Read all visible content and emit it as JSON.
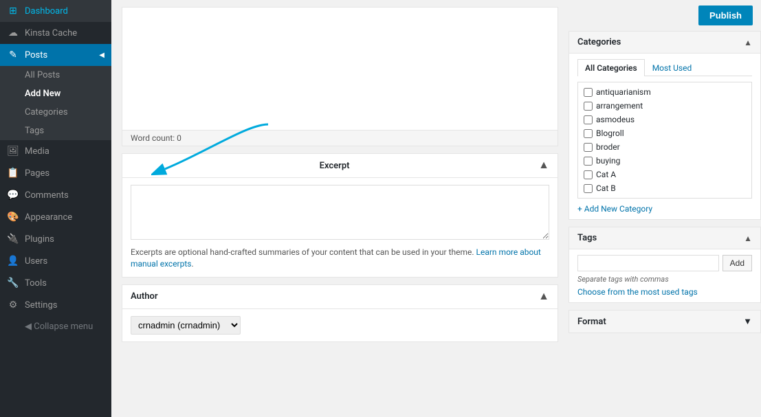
{
  "sidebar": {
    "items": [
      {
        "id": "dashboard",
        "label": "Dashboard",
        "icon": "⊞"
      },
      {
        "id": "kinsta-cache",
        "label": "Kinsta Cache",
        "icon": "☁"
      },
      {
        "id": "posts",
        "label": "Posts",
        "icon": "📄",
        "active": true
      },
      {
        "id": "media",
        "label": "Media",
        "icon": "🖼"
      },
      {
        "id": "pages",
        "label": "Pages",
        "icon": "📋"
      },
      {
        "id": "comments",
        "label": "Comments",
        "icon": "💬"
      },
      {
        "id": "appearance",
        "label": "Appearance",
        "icon": "🎨"
      },
      {
        "id": "plugins",
        "label": "Plugins",
        "icon": "🔌"
      },
      {
        "id": "users",
        "label": "Users",
        "icon": "👤"
      },
      {
        "id": "tools",
        "label": "Tools",
        "icon": "🔧"
      },
      {
        "id": "settings",
        "label": "Settings",
        "icon": "⚙"
      }
    ],
    "posts_subitems": [
      {
        "id": "all-posts",
        "label": "All Posts"
      },
      {
        "id": "add-new",
        "label": "Add New",
        "active": true
      },
      {
        "id": "categories",
        "label": "Categories"
      },
      {
        "id": "tags",
        "label": "Tags"
      }
    ],
    "collapse_label": "Collapse menu"
  },
  "main": {
    "word_count_label": "Word count: 0",
    "excerpt_section": {
      "title": "Excerpt",
      "placeholder": "",
      "help_text": "Excerpts are optional hand-crafted summaries of your content that can be used in your theme.",
      "learn_more_text": "Learn more about manual excerpts",
      "learn_more_url": "#"
    },
    "author_section": {
      "title": "Author",
      "selected": "crnadmin (crnadmin)"
    }
  },
  "right_panel": {
    "publish_button": "Publish",
    "categories": {
      "title": "Categories",
      "tabs": [
        {
          "id": "all",
          "label": "All Categories",
          "active": true
        },
        {
          "id": "most-used",
          "label": "Most Used"
        }
      ],
      "items": [
        {
          "label": "antiquarianism",
          "checked": false
        },
        {
          "label": "arrangement",
          "checked": false
        },
        {
          "label": "asmodeus",
          "checked": false
        },
        {
          "label": "Blogroll",
          "checked": false
        },
        {
          "label": "broder",
          "checked": false
        },
        {
          "label": "buying",
          "checked": false
        },
        {
          "label": "Cat A",
          "checked": false
        },
        {
          "label": "Cat B",
          "checked": false
        }
      ],
      "add_link": "+ Add New Category"
    },
    "tags": {
      "title": "Tags",
      "add_button": "Add",
      "placeholder": "",
      "hint": "Separate tags with commas",
      "choose_link": "Choose from the most used tags"
    },
    "format": {
      "title": "Format"
    }
  }
}
